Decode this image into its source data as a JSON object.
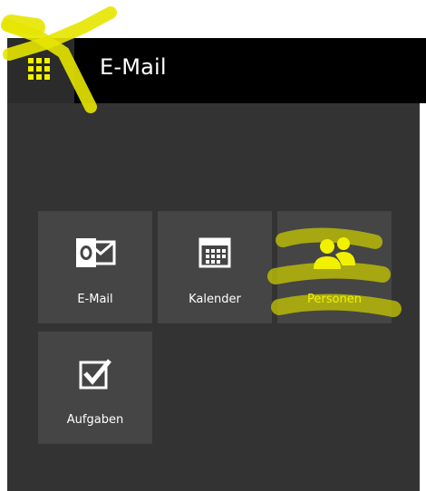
{
  "header": {
    "title": "E-Mail"
  },
  "tiles": [
    {
      "id": "mail",
      "label": "E-Mail",
      "icon": "outlook-mail-icon"
    },
    {
      "id": "calendar",
      "label": "Kalender",
      "icon": "calendar-icon"
    },
    {
      "id": "people",
      "label": "Personen",
      "icon": "people-icon"
    },
    {
      "id": "tasks",
      "label": "Aufgaben",
      "icon": "tasks-checkbox-icon"
    }
  ],
  "colors": {
    "header_bg": "#000000",
    "panel_bg": "#333333",
    "tile_bg": "#454545",
    "accent_yellow": "#f2f200",
    "highlight_yellow": "#e6e600"
  }
}
